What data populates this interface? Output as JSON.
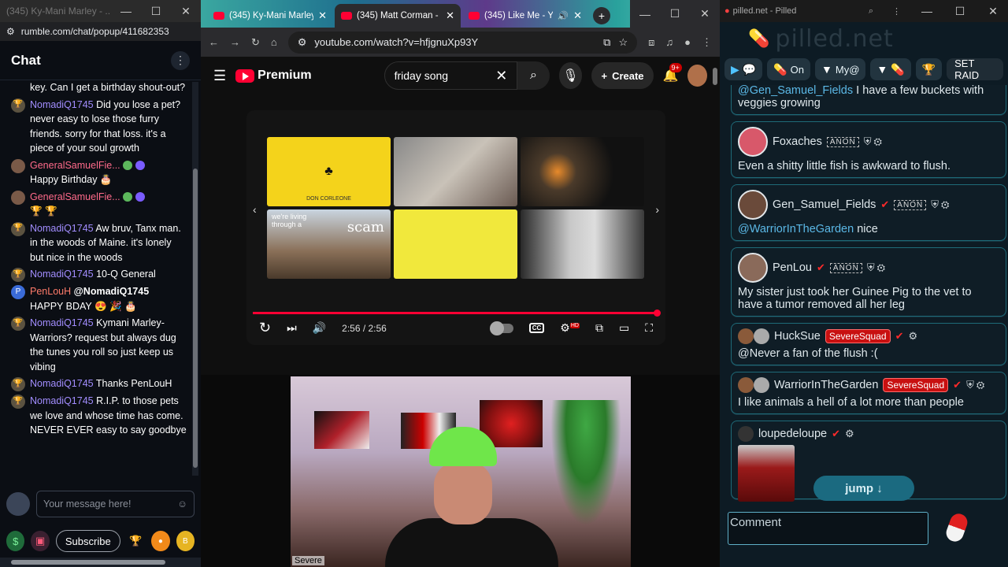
{
  "rumble": {
    "window_title": "(345) Ky-Mani Marley - ...",
    "url": "rumble.com/chat/popup/411682353",
    "header_title": "Chat",
    "messages": [
      {
        "user": "",
        "text": "key. Can I get a birthday shout-out?",
        "kind": "nomad"
      },
      {
        "user": "NomadiQ1745",
        "text": "Did you lose a pet? never easy to lose those furry friends. sorry for that loss. it's a piece of your soul growth",
        "kind": "nomad"
      },
      {
        "user": "GeneralSamuelFie...",
        "text": "Happy Birthday 🎂",
        "kind": "gen"
      },
      {
        "user": "GeneralSamuelFie...",
        "text": "🏆 🏆",
        "kind": "gen"
      },
      {
        "user": "NomadiQ1745",
        "text": "Aw bruv, Tanx man. in the woods of Maine. it's lonely but nice in the woods",
        "kind": "nomad"
      },
      {
        "user": "NomadiQ1745",
        "text": "10-Q General",
        "kind": "nomad"
      },
      {
        "user": "PenLouH",
        "mention": "@NomadiQ1745",
        "text": "HAPPY BDAY 😍 🎉 🎂",
        "kind": "pen",
        "avatar_letter": "P"
      },
      {
        "user": "NomadiQ1745",
        "text": "Kymani Marley-Warriors? request but always dug the tunes you roll so just keep us vibing",
        "kind": "nomad"
      },
      {
        "user": "NomadiQ1745",
        "text": "Thanks PenLouH",
        "kind": "nomad"
      },
      {
        "user": "NomadiQ1745",
        "text": "R.I.P. to those pets we love and whose time has come. NEVER EVER easy to say goodbye",
        "kind": "nomad"
      }
    ],
    "input_placeholder": "Your message here!",
    "subscribe_label": "Subscribe"
  },
  "browser": {
    "tabs": [
      {
        "label": "(345) Ky-Mani Marley",
        "active": false
      },
      {
        "label": "(345) Matt Corman -",
        "active": true
      },
      {
        "label": "(345) Like Me - Yo",
        "active": false
      }
    ],
    "url": "youtube.com/watch?v=hfjgnuXp93Y"
  },
  "youtube": {
    "brand": "Premium",
    "search_value": "friday song",
    "create_label": "Create",
    "notification_count": "9+",
    "thumb_texts": [
      "DON CORLEONE",
      "scam",
      "we're living through a"
    ],
    "time": "2:56 / 2:56",
    "progress": 1.0,
    "cc_label": "CC",
    "hd_label": "HD"
  },
  "webcam": {
    "label": "Severe"
  },
  "pilled": {
    "window_title": "pilled.net - Pilled",
    "logo": "pilled.net",
    "toolbar": {
      "on_label": "On",
      "my_label": "My@",
      "raid_label": "SET RAID"
    },
    "anon_label": "ANON",
    "posts": [
      {
        "user": "",
        "mention": "@Gen_Samuel_Fields",
        "text": "I have a few buckets with veggies growing"
      },
      {
        "user": "Foxaches",
        "mention": "",
        "text": "Even a shitty little fish is awkward to flush."
      },
      {
        "user": "Gen_Samuel_Fields",
        "mention": "@WarriorInTheGarden",
        "text": "nice"
      },
      {
        "user": "PenLou",
        "mention": "",
        "text": "My sister just took her Guinee Pig to the vet to have a tumor removed all her leg"
      },
      {
        "user": "HuckSue",
        "tag": "SevereSquad",
        "mention": "",
        "text": "@Never a fan of the flush :("
      },
      {
        "user": "WarriorInTheGarden",
        "tag": "SevereSquad",
        "mention": "",
        "text": "I like animals a hell of a lot more than people"
      },
      {
        "user": "loupedeloupe",
        "mention": "",
        "text": ""
      }
    ],
    "jump_label": "jump ↓",
    "comment_placeholder": "Comment"
  },
  "colors": {
    "youtube_red": "#ff0033",
    "rumble_name_purple": "#a28dff",
    "rumble_name_pink": "#ff6a8a",
    "pilled_accent": "#1e6a78",
    "severe_tag": "#c81010"
  }
}
